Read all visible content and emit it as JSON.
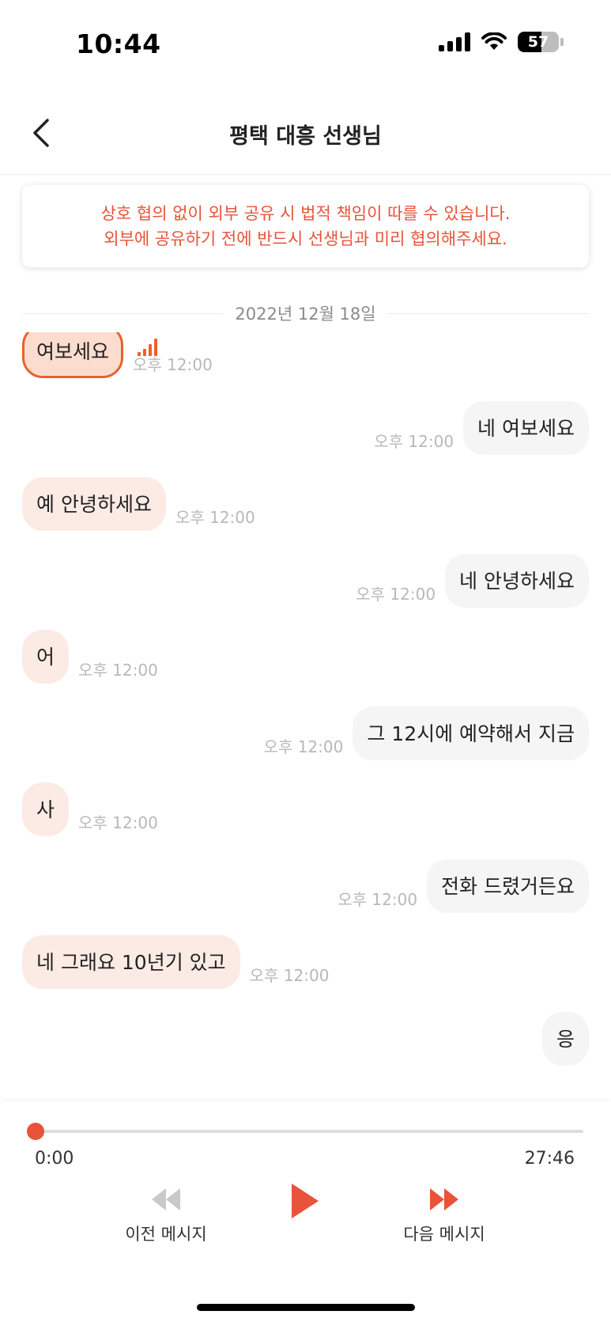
{
  "status_bar": {
    "time": "10:44",
    "battery": "57",
    "battery_level": 0.57
  },
  "header": {
    "title": "평택 대흥 선생님"
  },
  "warning": {
    "line1": "상호 협의 없이 외부 공유 시 법적 책임이 따를 수 있습니다.",
    "line2": "외부에 공유하기 전에 반드시 선생님과 미리 협의해주세요."
  },
  "date_divider": "2022년 12월 18일",
  "messages": [
    {
      "side": "left",
      "text": "여보세요",
      "time": "오후 12:00",
      "active": true
    },
    {
      "side": "right",
      "text": "네 여보세요",
      "time": "오후 12:00"
    },
    {
      "side": "left",
      "text": "예 안녕하세요",
      "time": "오후 12:00"
    },
    {
      "side": "right",
      "text": "네 안녕하세요",
      "time": "오후 12:00"
    },
    {
      "side": "left",
      "text": "어",
      "time": "오후 12:00"
    },
    {
      "side": "right",
      "text": "그 12시에 예약해서 지금",
      "time": "오후 12:00"
    },
    {
      "side": "left",
      "text": "사",
      "time": "오후 12:00"
    },
    {
      "side": "right",
      "text": "전화 드렸거든요",
      "time": "오후 12:00"
    },
    {
      "side": "left",
      "text": "네 그래요 10년기 있고",
      "time": "오후 12:00"
    },
    {
      "side": "right",
      "text": "응",
      "time": ""
    }
  ],
  "player": {
    "current_time": "0:00",
    "total_time": "27:46",
    "progress": 0.0,
    "prev_label": "이전 메시지",
    "next_label": "다음 메시지"
  },
  "colors": {
    "accent": "#e8533a",
    "left_bubble": "#fcebe4",
    "right_bubble": "#f5f5f5"
  }
}
